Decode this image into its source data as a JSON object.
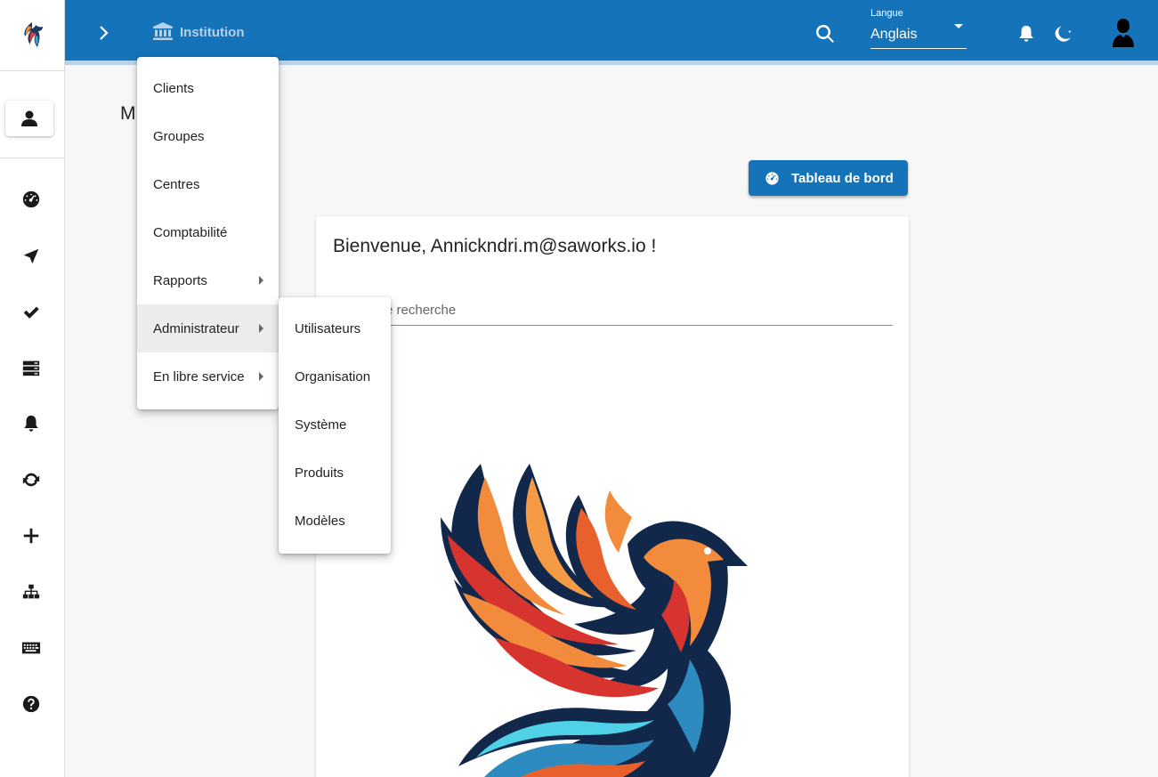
{
  "topbar": {
    "section_label": "Institution",
    "language": {
      "label": "Langue",
      "value": "Anglais"
    }
  },
  "page": {
    "title_partial": "M"
  },
  "dashboard_button": {
    "label": "Tableau de bord"
  },
  "card": {
    "welcome": "Bienvenue, Annickndri.m@saworks.io !",
    "search_placeholder_partial": "e recherche"
  },
  "menu": {
    "items": [
      {
        "label": "Clients",
        "has_submenu": false
      },
      {
        "label": "Groupes",
        "has_submenu": false
      },
      {
        "label": "Centres",
        "has_submenu": false
      },
      {
        "label": "Comptabilité",
        "has_submenu": false
      },
      {
        "label": "Rapports",
        "has_submenu": true
      },
      {
        "label": "Administrateur",
        "has_submenu": true,
        "active": true
      },
      {
        "label": "En libre service",
        "has_submenu": true
      }
    ]
  },
  "submenu": {
    "items": [
      {
        "label": "Utilisateurs"
      },
      {
        "label": "Organisation"
      },
      {
        "label": "Système"
      },
      {
        "label": "Produits"
      },
      {
        "label": "Modèles"
      }
    ]
  },
  "sidebar": {
    "icons": [
      "dashboard-icon",
      "navigation-icon",
      "check-icon",
      "server-icon",
      "bell-icon",
      "sync-icon",
      "plus-icon",
      "sitemap-icon",
      "keyboard-icon",
      "help-icon"
    ]
  },
  "colors": {
    "primary": "#1573b9",
    "accent_light": "#b9d4ea"
  }
}
